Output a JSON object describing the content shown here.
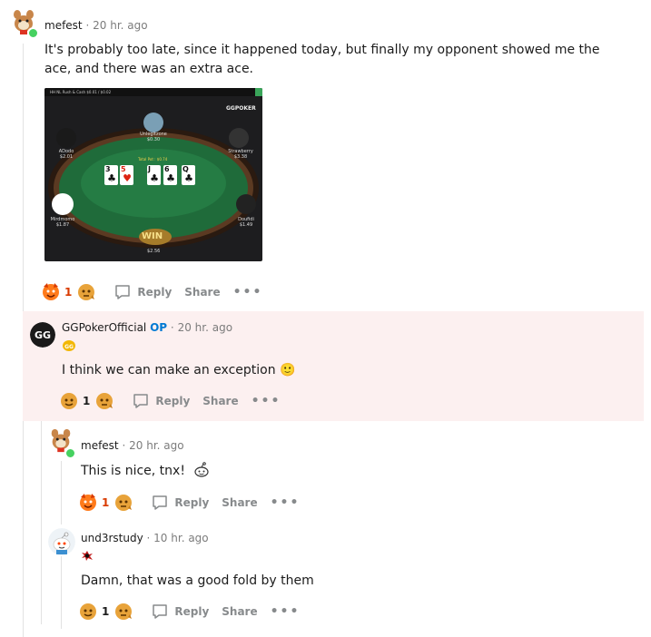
{
  "comments": [
    {
      "username": "mefest",
      "time": "20 hr. ago",
      "text": "It's probably too late, since it happened today, but finally my opponent showed me the ace, and there was an extra ace.",
      "votes": "1",
      "actions": {
        "reply": "Reply",
        "share": "Share",
        "more": "•••"
      },
      "image": {
        "game_title": "HH NL Rush & Cash $0.01 / $0.02",
        "brand": "GGPOKER",
        "total_pot": "Total Pot : $0.74",
        "board": [
          "3",
          "5",
          "J",
          "6",
          "Q"
        ],
        "win_label": "WIN",
        "win_amount": "$2.56",
        "players": [
          {
            "name": "Unlegitzone",
            "stack": "$0.30"
          },
          {
            "name": "ADodo",
            "stack": "$2.01"
          },
          {
            "name": "Mirdmomo",
            "stack": "$1.87"
          },
          {
            "name": "Strawberry",
            "stack": "$3.38"
          },
          {
            "name": "Doufidi",
            "stack": "$1.49"
          }
        ]
      }
    },
    {
      "username": "GGPokerOfficial",
      "op_badge": "OP",
      "time": "20 hr. ago",
      "text": "I think we can make an exception 🙂",
      "votes": "1",
      "actions": {
        "reply": "Reply",
        "share": "Share",
        "more": "•••"
      }
    },
    {
      "username": "mefest",
      "time": "20 hr. ago",
      "text": "This is nice, tnx!",
      "votes": "1",
      "actions": {
        "reply": "Reply",
        "share": "Share",
        "more": "•••"
      }
    },
    {
      "username": "und3rstudy",
      "time": "10 hr. ago",
      "text": "Damn, that was a good fold by them",
      "votes": "1",
      "actions": {
        "reply": "Reply",
        "share": "Share",
        "more": "•••"
      }
    }
  ],
  "separator": "·",
  "colors": {
    "upvote": "#d93a00",
    "op": "#0079d3",
    "op_background": "#fcf0f0",
    "online": "#46d160"
  }
}
